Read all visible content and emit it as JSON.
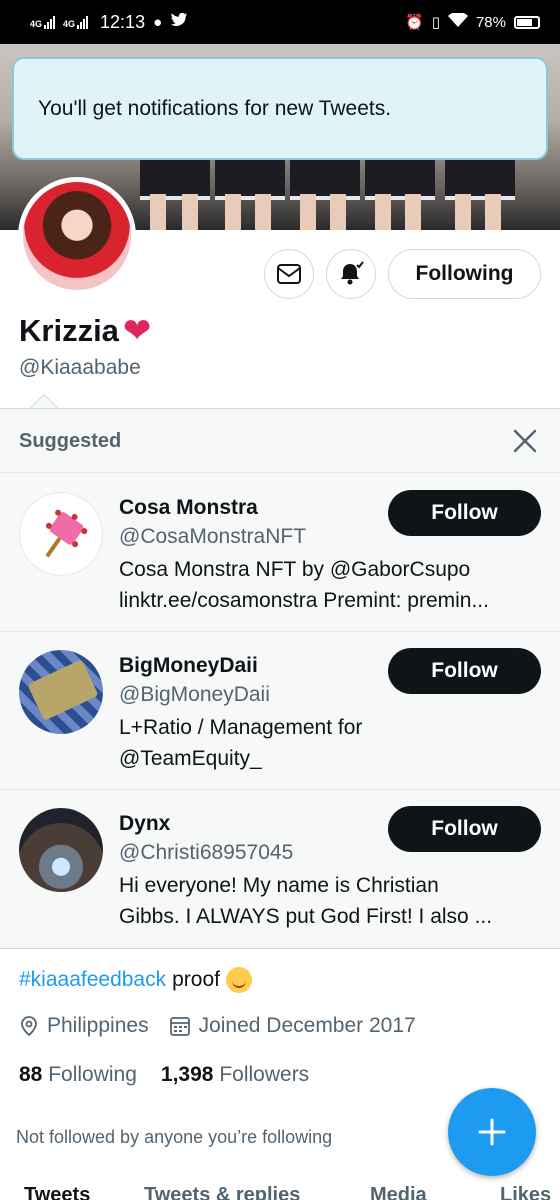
{
  "status_bar": {
    "network_1": "4G",
    "network_2": "4G",
    "time": "12:13",
    "battery": "78%"
  },
  "toast": {
    "message": "You'll get notifications for new Tweets."
  },
  "profile": {
    "display_name": "Krizzia",
    "handle": "@Kiaaababe",
    "following_button": "Following",
    "bio_hashtag": "#kiaaafeedback",
    "bio_text": "proof",
    "location": "Philippines",
    "joined": "Joined December 2017",
    "following_count": "88",
    "following_label": "Following",
    "followers_count": "1,398",
    "followers_label": "Followers",
    "not_followed_text": "Not followed by anyone you’re following"
  },
  "suggested": {
    "title": "Suggested",
    "accounts": [
      {
        "name": "Cosa Monstra",
        "handle": "@CosaMonstraNFT",
        "bio_line1": "Cosa Monstra NFT by @GaborCsupo",
        "bio_line2": "linktr.ee/cosamonstra Premint: premin...",
        "button": "Follow"
      },
      {
        "name": "BigMoneyDaii",
        "handle": "@BigMoneyDaii",
        "bio_line1": "L+Ratio / Management for",
        "bio_line2": "@TeamEquity_",
        "button": "Follow"
      },
      {
        "name": "Dynx",
        "handle": "@Christi68957045",
        "bio_line1": "Hi everyone! My name is Christian",
        "bio_line2": "Gibbs. I ALWAYS put God First! I also ...",
        "button": "Follow"
      }
    ]
  },
  "tabs": [
    "Tweets",
    "Tweets & replies",
    "Media",
    "Likes"
  ],
  "colors": {
    "accent": "#1d9bf0",
    "text": "#0f1419",
    "muted": "#536471",
    "heart": "#e0245e"
  }
}
